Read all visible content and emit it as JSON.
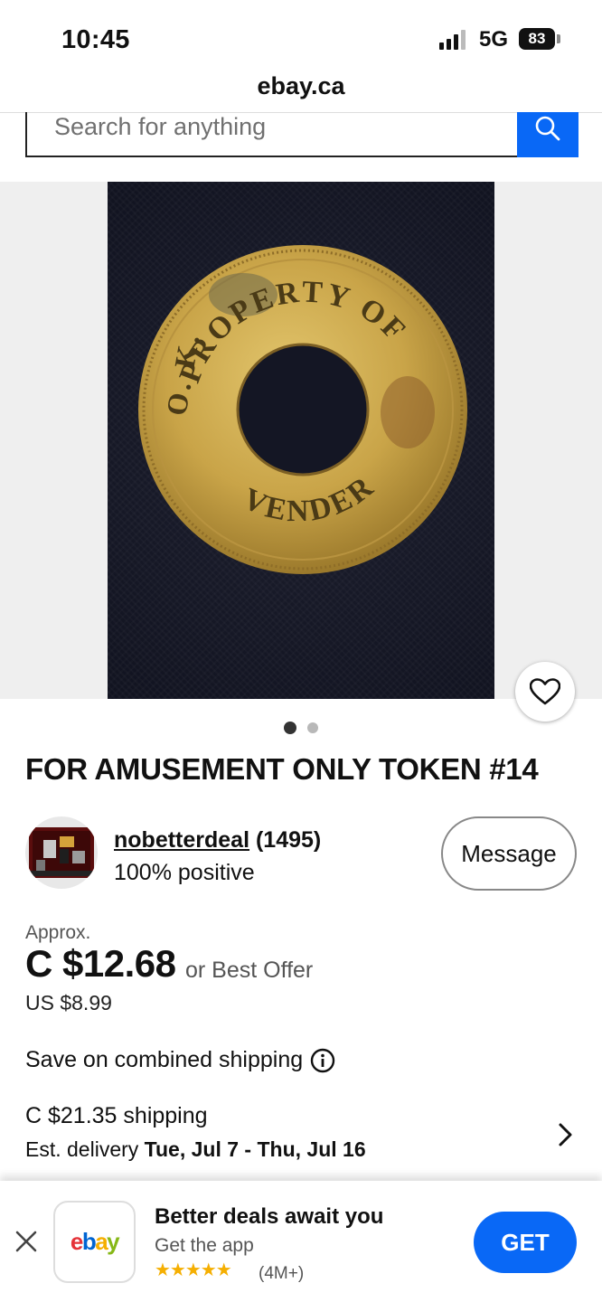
{
  "status_bar": {
    "time": "10:45",
    "network": "5G",
    "battery": "83"
  },
  "browser": {
    "url": "ebay.ca"
  },
  "search": {
    "placeholder": "Search for anything"
  },
  "gallery": {
    "token_text_top": "PROPERTY OF",
    "token_text_side": "O. K.",
    "token_text_bottom": "VENDER",
    "image_count": 2,
    "active_index": 0
  },
  "listing": {
    "title": "FOR AMUSEMENT ONLY TOKEN #14",
    "seller_name": "nobetterdeal",
    "seller_score": "(1495)",
    "seller_feedback": "100% positive",
    "message_label": "Message",
    "approx_label": "Approx.",
    "price": "C $12.68",
    "offer_text": "or Best Offer",
    "usd_price": "US $8.99",
    "combined_shipping": "Save on combined shipping",
    "shipping_cost": "C $21.35 shipping",
    "delivery_label": "Est. delivery",
    "delivery_dates": "Tue, Jul 7 - Thu, Jul 16"
  },
  "app_banner": {
    "title": "Better deals await you",
    "subtitle": "Get the app",
    "stars": "★★★★★",
    "rating_count": "(4M+)",
    "get_label": "GET",
    "logo_e": "e",
    "logo_b": "b",
    "logo_a": "a",
    "logo_y": "y"
  },
  "colors": {
    "accent": "#0968f6",
    "star": "#f5af02"
  }
}
